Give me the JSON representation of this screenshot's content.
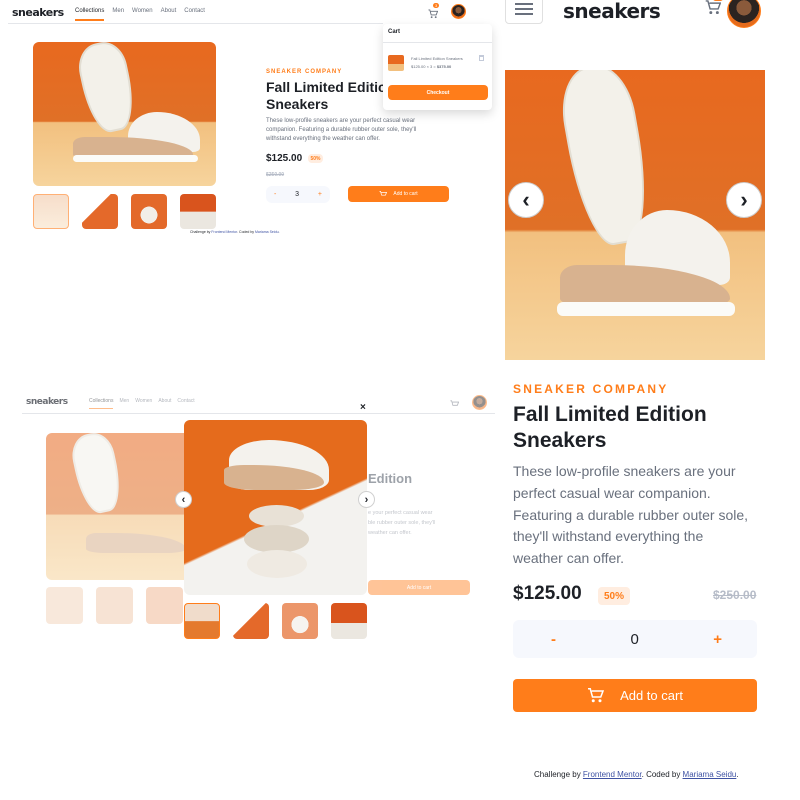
{
  "brand": "sneakers",
  "nav": [
    "Collections",
    "Men",
    "Women",
    "About",
    "Contact"
  ],
  "cart_count": "3",
  "cart_count_mobile": "",
  "product": {
    "company": "SNEAKER COMPANY",
    "title": "Fall Limited Edition Sneakers",
    "title_line1": "Fall Limited Edition",
    "title_line2": "Sneakers",
    "title_partial": "Fall Limited Editic",
    "desc": "These low-profile sneakers are your perfect casual wear companion. Featuring a durable rubber outer sole, they'll withstand everything the weather can offer.",
    "desc_m1": "These low-profile sneakers are your",
    "desc_m2": "perfect casual wear companion.",
    "desc_m3": "Featuring a durable rubber outer sole,",
    "desc_m4": "they'll withstand everything the",
    "desc_m5": "weather can offer.",
    "price": "$125.00",
    "discount": "50%",
    "old_price": "$250.00",
    "quantity_desktop": "3",
    "quantity_mobile": "0",
    "minus": "-",
    "plus": "+",
    "add_to_cart": "Add to cart"
  },
  "cart": {
    "title": "Cart",
    "item_name": "Fall Limited Edition Sneakers",
    "item_calc": "$125.00 × 3",
    "item_total": "$375.00",
    "checkout": "Checkout"
  },
  "lightbox": {
    "close": "×",
    "title_partial": "Edition",
    "desc_l1": "e your perfect casual wear",
    "desc_l2": "ble rubber outer sole, they'll",
    "desc_l3": "weather can offer.",
    "add_to_cart": "Add to cart"
  },
  "footer": {
    "prefix": "Challenge by ",
    "fm": "Frontend Mentor",
    "mid": ". Coded by ",
    "author": "Mariama Seidu",
    "end": "."
  },
  "icons": {
    "prev": "‹",
    "next": "›",
    "cart": "cart-icon",
    "menu": "menu-icon",
    "delete": "trash-icon"
  },
  "colors": {
    "accent": "#ff7d1a",
    "accent_pale": "#ffede0",
    "dark": "#1d2026",
    "muted": "#69707d"
  }
}
